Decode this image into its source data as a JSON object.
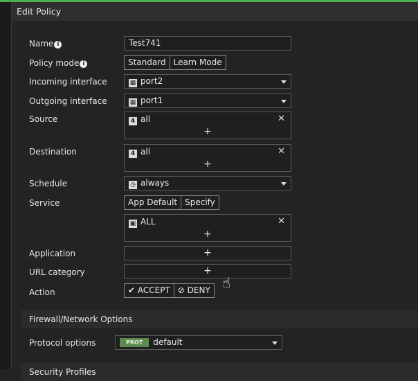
{
  "header": {
    "title": "Edit Policy"
  },
  "form": {
    "name": {
      "label": "Name",
      "value": "Test741"
    },
    "policy_mode": {
      "label": "Policy mode",
      "options": [
        "Standard",
        "Learn Mode"
      ]
    },
    "incoming": {
      "label": "Incoming interface",
      "value": "port2"
    },
    "outgoing": {
      "label": "Outgoing interface",
      "value": "port1"
    },
    "source": {
      "label": "Source",
      "value": "all",
      "add": "+"
    },
    "destination": {
      "label": "Destination",
      "value": "all",
      "add": "+"
    },
    "schedule": {
      "label": "Schedule",
      "value": "always"
    },
    "service": {
      "label": "Service",
      "options": [
        "App Default",
        "Specify"
      ],
      "value": "ALL",
      "add": "+"
    },
    "application": {
      "label": "Application",
      "add": "+"
    },
    "url_category": {
      "label": "URL category",
      "add": "+"
    },
    "action": {
      "label": "Action",
      "accept": "ACCEPT",
      "deny": "DENY"
    }
  },
  "firewall": {
    "title": "Firewall/Network Options",
    "protocol_label": "Protocol options",
    "badge": "PROT",
    "protocol_value": "default"
  },
  "security": {
    "title": "Security Profiles"
  }
}
